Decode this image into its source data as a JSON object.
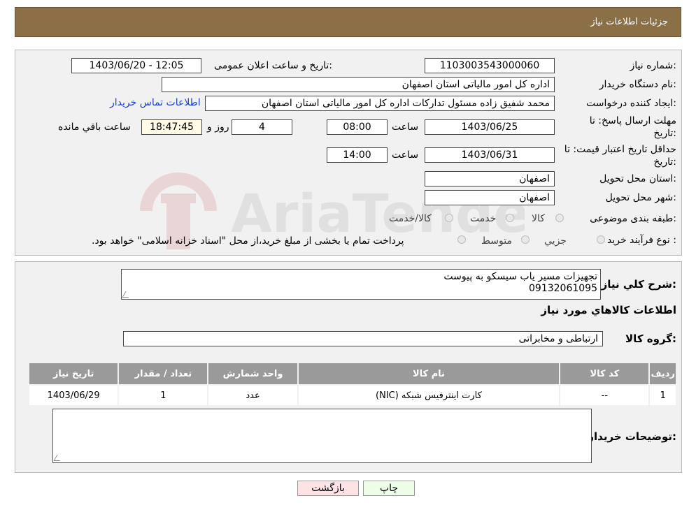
{
  "header": {
    "title": "جزئیات اطلاعات نیاز"
  },
  "form": {
    "need_number_label": "شماره نیاز:",
    "need_number": "1103003543000060",
    "announce_label": "تاریخ و ساعت اعلان عمومی:",
    "announce_value": "1403/06/20 - 12:05",
    "buyer_org_label": "نام دستگاه خریدار:",
    "buyer_org": "اداره کل امور مالیاتی استان اصفهان",
    "requester_label": "ایجاد کننده درخواست:",
    "requester": "محمد شفیق زاده مسئول تدارکات اداره کل امور مالیاتی استان اصفهان",
    "contact_link": "اطلاعات تماس خریدار",
    "deadline_label_line1": "مهلت ارسال پاسخ: تا",
    "deadline_label_line2": "تاریخ:",
    "deadline_date": "1403/06/25",
    "time_label": "ساعت",
    "deadline_time": "08:00",
    "days_value": "4",
    "days_label": "روز و",
    "remaining_time": "18:47:45",
    "remaining_label": "ساعت باقي مانده",
    "validity_label_line1": "حداقل تاریخ اعتبار قیمت: تا",
    "validity_label_line2": "تاریخ:",
    "validity_date": "1403/06/31",
    "validity_time": "14:00",
    "province_label": "استان محل تحویل:",
    "province": "اصفهان",
    "city_label": "شهر محل تحویل:",
    "city": "اصفهان",
    "category_label": "طبقه بندی موضوعی:",
    "category_options": [
      "کالا",
      "خدمت",
      "کالا/خدمت"
    ],
    "process_label": "نوع فرآیند خرید :",
    "process_options": [
      "جزیي",
      "متوسط"
    ],
    "process_note": "پرداخت تمام یا بخشی از مبلغ خرید،از محل \"اسناد خزانه اسلامی\" خواهد بود."
  },
  "details": {
    "summary_label": "شرح کلي نياز:",
    "summary_line1": "تجهیزات مسیر یاب  سیسکو به پیوست",
    "summary_line2": "09132061095",
    "goods_info_title": "اطلاعات کالاهاي مورد نياز",
    "goods_group_label": "گروه کالا:",
    "goods_group": "ارتباطی و مخابراتی",
    "table": {
      "headers": [
        "ردیف",
        "کد کالا",
        "نام کالا",
        "واحد شمارش",
        "تعداد / مقدار",
        "تاریخ نیاز"
      ],
      "rows": [
        [
          "1",
          "--",
          "کارت اینترفیس شبکه (NIC)",
          "عدد",
          "1",
          "1403/06/29"
        ]
      ]
    },
    "buyer_notes_label": "توضیحات خریدار:"
  },
  "buttons": {
    "print": "چاپ",
    "back": "بازگشت"
  },
  "watermark_text": "AriaTender.neT",
  "colors": {
    "header_bg": "#8b6f47",
    "link": "#1a3fd6",
    "back_btn": "#fde3e3",
    "print_btn": "#eefde8"
  }
}
